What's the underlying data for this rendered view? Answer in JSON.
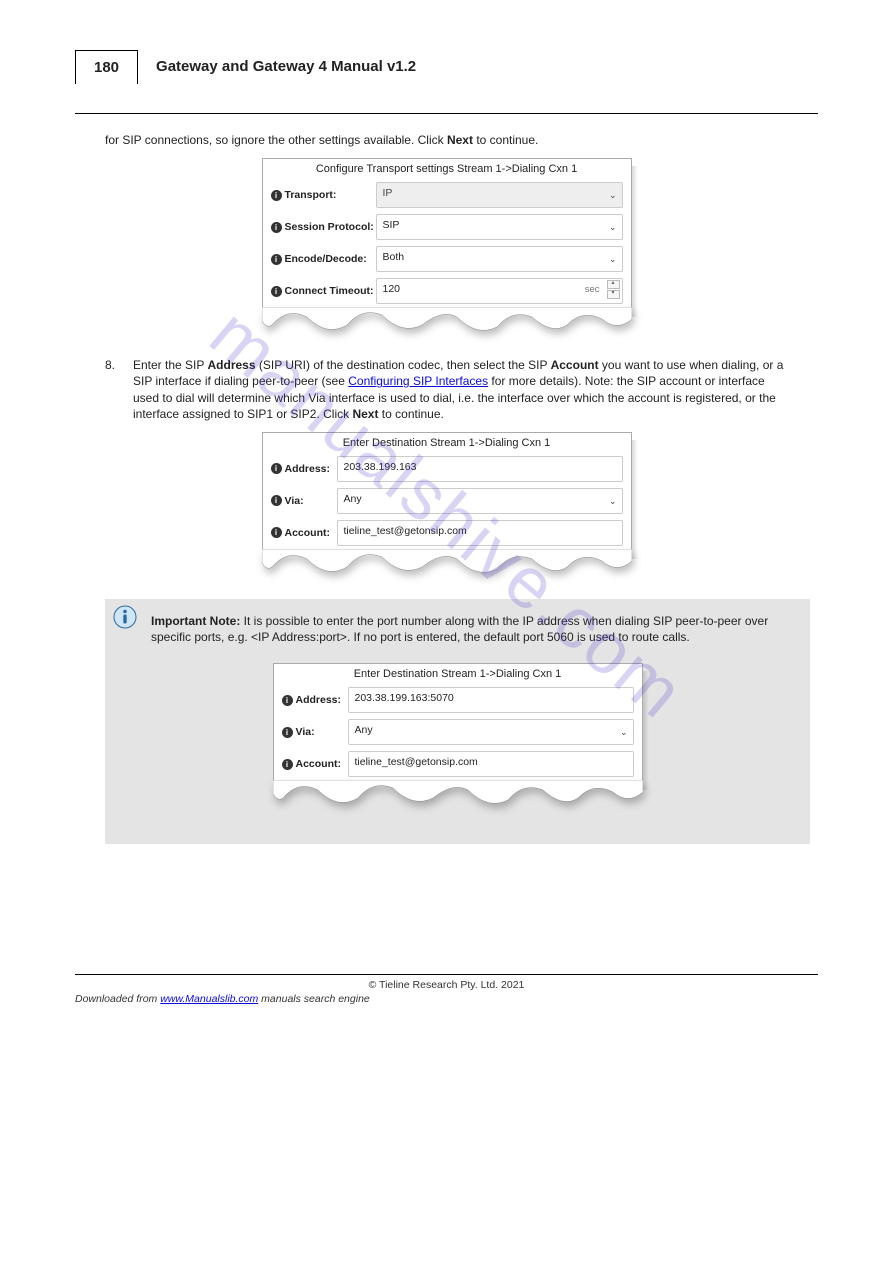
{
  "page": {
    "number": "180",
    "header_title": "Gateway and Gateway 4 Manual v1.2"
  },
  "intro_text": "for SIP connections, so ignore the other settings available. Click Next to continue.",
  "panel1": {
    "title": "Configure Transport settings Stream 1->Dialing Cxn 1",
    "rows": {
      "transport": {
        "label": "Transport:",
        "value": "IP"
      },
      "session": {
        "label": "Session Protocol:",
        "value": "SIP"
      },
      "encdec": {
        "label": "Encode/Decode:",
        "value": "Both"
      },
      "timeout": {
        "label": "Connect Timeout:",
        "value": "120",
        "unit": "sec"
      }
    }
  },
  "step8": {
    "num": "8.",
    "before_link": "Enter the SIP ",
    "bold1": "Address",
    "mid1": " (SIP URI) of the destination codec, then select the SIP ",
    "bold2": "Account",
    "after": " you want to use when dialing, or a SIP interface if dialing peer-to-peer (see ",
    "link_text": "Configuring SIP Interfaces",
    "after_link": " for more details). Note: the SIP account or interface used to dial will determine which Via interface is used to dial, i.e. the interface over which the account is registered, or the interface assigned to SIP1 or SIP2. Click ",
    "bold3": "Next",
    "tail": " to continue."
  },
  "panel2": {
    "title": "Enter Destination Stream 1->Dialing Cxn 1",
    "rows": {
      "address": {
        "label": "Address:",
        "value": "203.38.199.163"
      },
      "via": {
        "label": "Via:",
        "value": "Any"
      },
      "account": {
        "label": "Account:",
        "value": "tieline_test@getonsip.com"
      }
    }
  },
  "note": {
    "heading": "Important Note:",
    "text": " It is possible to enter the port number along with the IP address when dialing SIP peer-to-peer over specific ports, e.g. <IP Address:port>. If no port is entered, the default port 5060 is used to route calls."
  },
  "panel3": {
    "title": "Enter Destination Stream 1->Dialing Cxn 1",
    "rows": {
      "address": {
        "label": "Address:",
        "value": "203.38.199.163:5070"
      },
      "via": {
        "label": "Via:",
        "value": "Any"
      },
      "account": {
        "label": "Account:",
        "value": "tieline_test@getonsip.com"
      }
    }
  },
  "footer": {
    "copyright": "© Tieline Research Pty. Ltd. 2021",
    "download_prefix": "Downloaded from ",
    "link_text": "www.Manualslib.com",
    "suffix": " manuals search engine"
  },
  "watermark": "manualshive.com"
}
